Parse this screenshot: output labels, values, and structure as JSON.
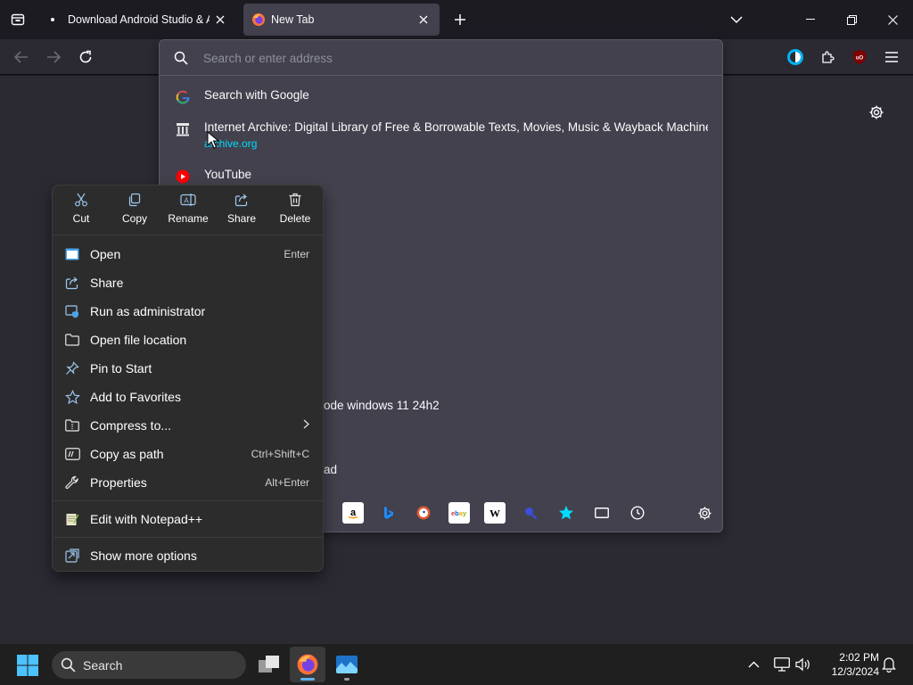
{
  "tabs": {
    "inactive": {
      "title": "Download Android Studio & App Tools"
    },
    "active": {
      "title": "New Tab"
    }
  },
  "urlbar": {
    "placeholder": "Search or enter address",
    "results": [
      {
        "title": "Search with Google",
        "icon": "google-icon"
      },
      {
        "title": "Internet Archive: Digital Library of Free & Borrowable Texts, Movies, Music & Wayback Machine",
        "url": "archive.org",
        "icon": "archive-icon"
      },
      {
        "title": "YouTube",
        "icon": "youtube-icon"
      }
    ],
    "partial_results": [
      "ode windows 11 24h2",
      "ad"
    ],
    "engines": [
      "amazon",
      "bing",
      "duckduckgo",
      "ebay",
      "wikipedia",
      "search",
      "bookmarks",
      "tabs",
      "history"
    ]
  },
  "context_menu": {
    "actions": [
      {
        "label": "Cut",
        "icon": "scissors-icon"
      },
      {
        "label": "Copy",
        "icon": "copy-icon"
      },
      {
        "label": "Rename",
        "icon": "rename-icon"
      },
      {
        "label": "Share",
        "icon": "share-icon"
      },
      {
        "label": "Delete",
        "icon": "trash-icon"
      }
    ],
    "items": [
      {
        "label": "Open",
        "shortcut": "Enter",
        "icon": "open-window-icon"
      },
      {
        "label": "Share",
        "shortcut": "",
        "icon": "share-icon"
      },
      {
        "label": "Run as administrator",
        "shortcut": "",
        "icon": "admin-shield-icon"
      },
      {
        "label": "Open file location",
        "shortcut": "",
        "icon": "folder-icon"
      },
      {
        "label": "Pin to Start",
        "shortcut": "",
        "icon": "pin-icon"
      },
      {
        "label": "Add to Favorites",
        "shortcut": "",
        "icon": "star-icon"
      },
      {
        "label": "Compress to...",
        "shortcut": "",
        "icon": "zip-folder-icon"
      },
      {
        "label": "Copy as path",
        "shortcut": "Ctrl+Shift+C",
        "icon": "path-icon"
      },
      {
        "label": "Properties",
        "shortcut": "Alt+Enter",
        "icon": "wrench-icon"
      }
    ],
    "extra_item": {
      "label": "Edit with Notepad++",
      "icon": "notepad-plus-icon"
    },
    "more_item": {
      "label": "Show more options",
      "icon": "more-options-icon"
    }
  },
  "taskbar": {
    "search_label": "Search",
    "clock_time": "2:02 PM",
    "clock_date": "12/3/2024"
  },
  "colors": {
    "accent": "#00ddff",
    "taskbar_indicator": "#5fb2f2",
    "youtube_red": "#ff0000"
  }
}
